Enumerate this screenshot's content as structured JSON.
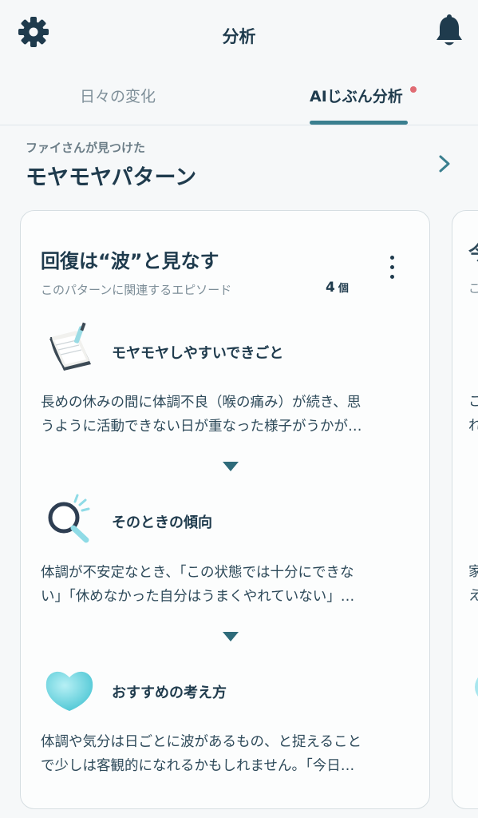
{
  "header": {
    "title": "分析",
    "settings_icon": "gear-icon",
    "notification_icon": "bell-icon"
  },
  "tabs": [
    {
      "label": "日々の変化",
      "active": false
    },
    {
      "label": "AIじぶん分析",
      "active": true,
      "has_badge": true
    }
  ],
  "section": {
    "eyebrow": "ファイさんが見つけた",
    "title": "モヤモヤパターン"
  },
  "card": {
    "title": "回復は“波”と見なす",
    "subtitle": "このパターンに関連するエピソード",
    "count_value": "4",
    "count_unit": "個",
    "sections": [
      {
        "icon": "notebook-icon",
        "heading": "モヤモヤしやすいできごと",
        "line1": "長めの休みの間に体調不良（喉の痛み）が続き、思",
        "line2": "うように活動できない日が重なった様子がうかが…"
      },
      {
        "icon": "magnifier-icon",
        "heading": "そのときの傾向",
        "line1": "体調が不安定なとき、「この状態では十分にできな",
        "line2": "い」「休めなかった自分はうまくやれていない」…"
      },
      {
        "icon": "heart-icon",
        "heading": "おすすめの考え方",
        "line1": "体調や気分は日ごとに波があるもの、と捉えること",
        "line2": "で少しは客観的になれるかもしれません。「今日…"
      }
    ]
  },
  "next_card_peek": {
    "top": "今",
    "sub": "こ",
    "a": "こ",
    "b": "れ",
    "c": "家",
    "d": "え"
  },
  "colors": {
    "accent": "#3a7f8f",
    "badge": "#e06b73",
    "text": "#1f3b4d",
    "heart": "#5fd0dc"
  }
}
